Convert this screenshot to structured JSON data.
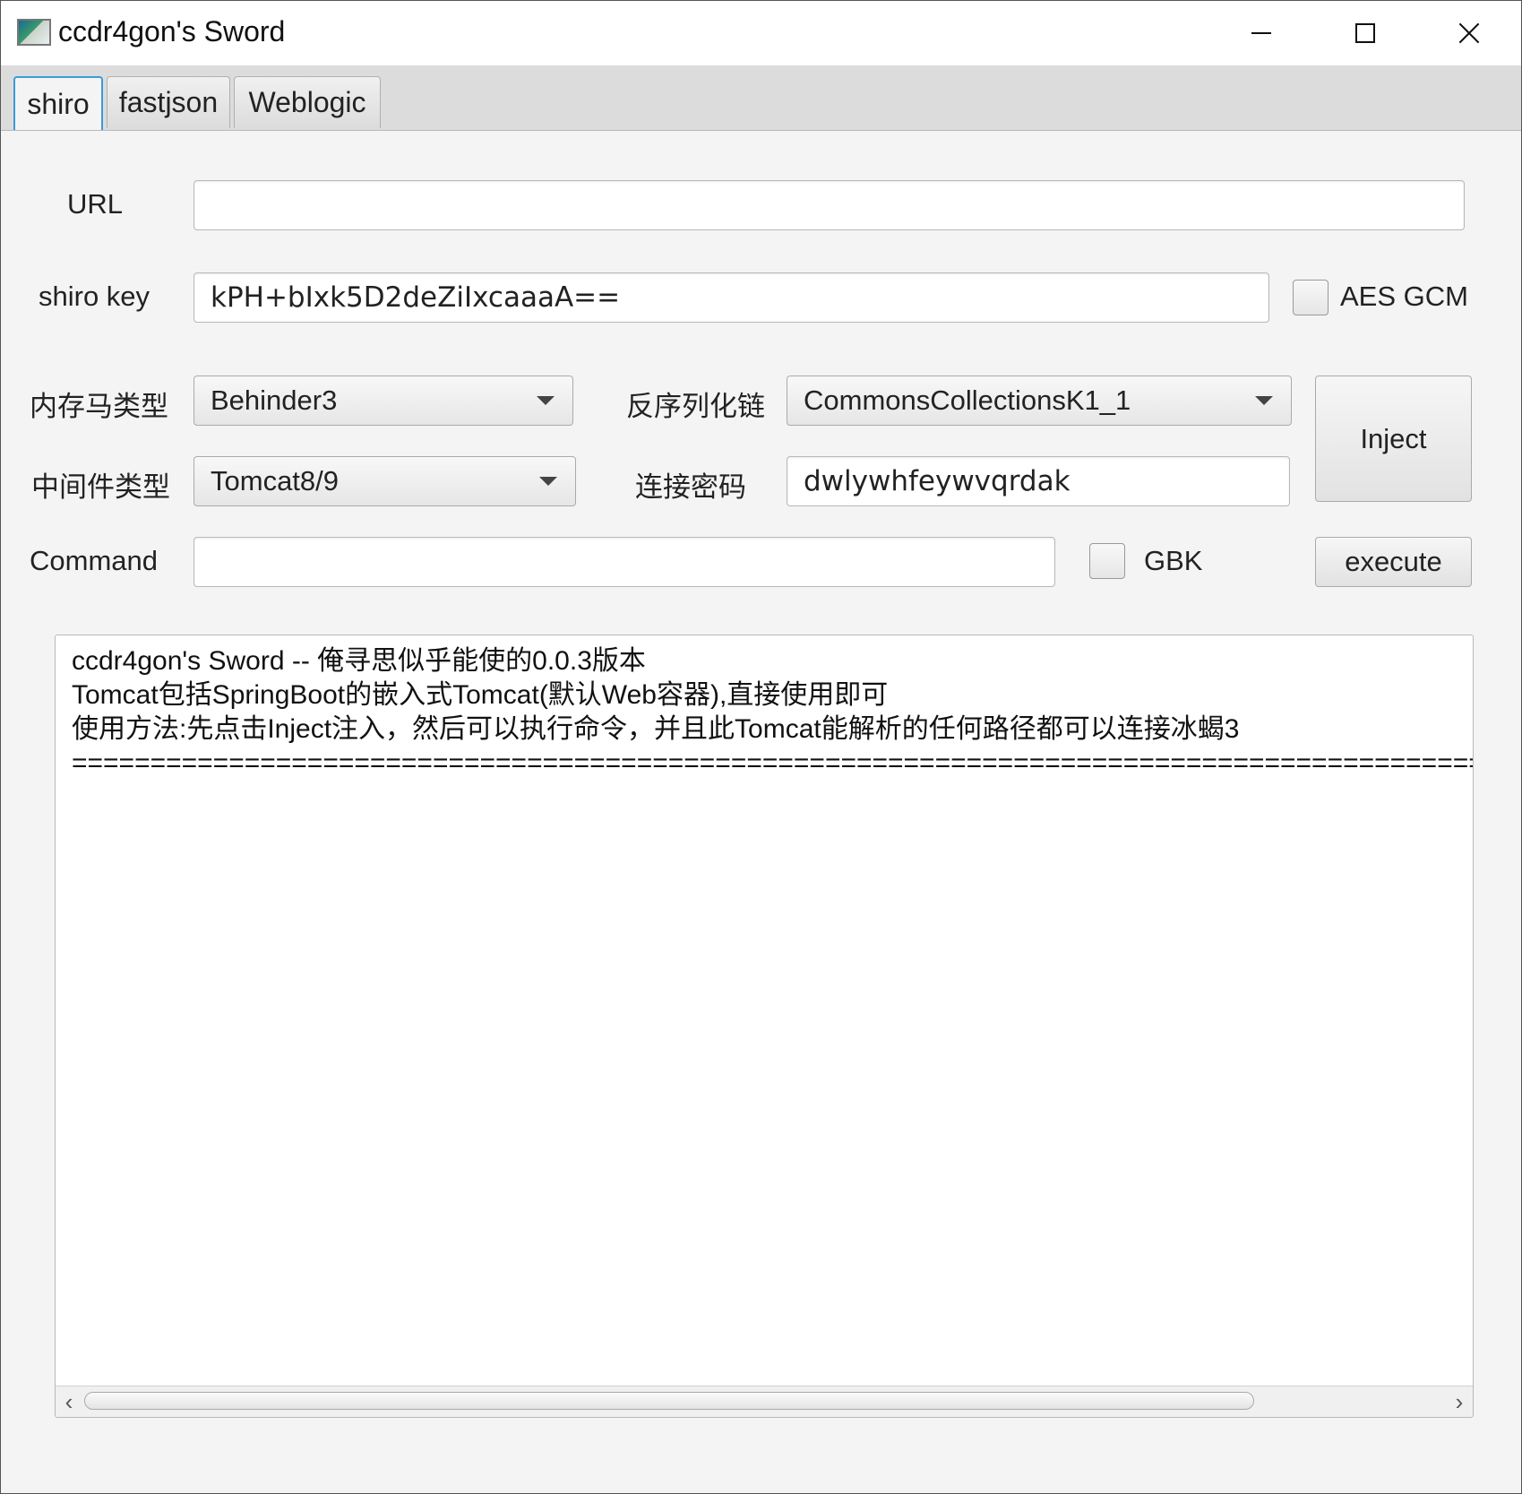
{
  "window": {
    "title": "ccdr4gon's Sword",
    "icon": "app-icon"
  },
  "tabs": [
    {
      "label": "shiro",
      "active": true
    },
    {
      "label": "fastjson",
      "active": false
    },
    {
      "label": "Weblogic",
      "active": false
    }
  ],
  "form": {
    "url_label": "URL",
    "url_value": "",
    "shiro_key_label": "shiro key",
    "shiro_key_value": "kPH+bIxk5D2deZiIxcaaaA==",
    "aes_gcm_label": "AES GCM",
    "aes_gcm_checked": false,
    "memshell_type_label": "内存马类型",
    "memshell_type_value": "Behinder3",
    "gadget_label": "反序列化链",
    "gadget_value": "CommonsCollectionsK1_1",
    "middleware_label": "中间件类型",
    "middleware_value": "Tomcat8/9",
    "password_label": "连接密码",
    "password_value": "dwlywhfeywvqrdak",
    "inject_label": "Inject",
    "command_label": "Command",
    "command_value": "",
    "gbk_label": "GBK",
    "gbk_checked": false,
    "execute_label": "execute"
  },
  "output": {
    "lines": [
      "ccdr4gon's Sword -- 俺寻思似乎能使的0.0.3版本",
      "Tomcat包括SpringBoot的嵌入式Tomcat(默认Web容器),直接使用即可",
      "使用方法:先点击Inject注入，然后可以执行命令，并且此Tomcat能解析的任何路径都可以连接冰蝎3",
      "========================================================================================================"
    ]
  }
}
